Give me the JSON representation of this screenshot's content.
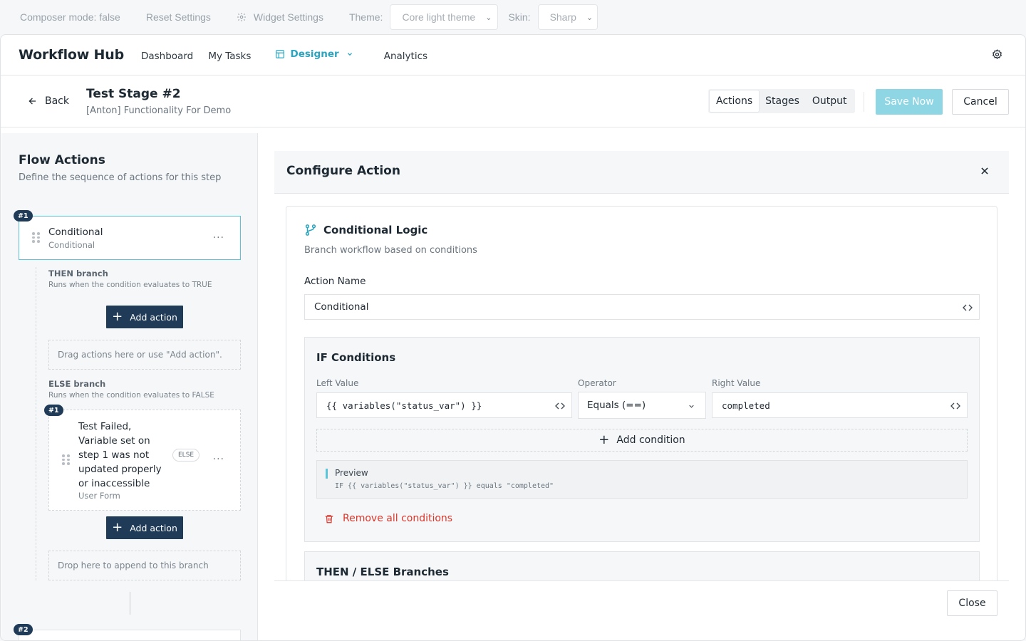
{
  "composer": {
    "mode": "Composer mode: false",
    "reset": "Reset Settings",
    "widget": "Widget Settings",
    "theme_label": "Theme:",
    "theme_value": "Core light theme",
    "skin_label": "Skin:",
    "skin_value": "Sharp"
  },
  "navbar": {
    "brand": "Workflow Hub",
    "items": [
      "Dashboard",
      "My Tasks",
      "Designer",
      "Analytics"
    ],
    "active": "Designer"
  },
  "subheader": {
    "back": "Back",
    "title": "Test Stage #2",
    "subtitle": "[Anton] Functionality For Demo",
    "tabs": [
      "Actions",
      "Stages",
      "Output"
    ],
    "active_tab": "Actions",
    "save": "Save Now",
    "cancel": "Cancel"
  },
  "flow": {
    "title": "Flow Actions",
    "description": "Define the sequence of actions for this step",
    "action1": {
      "badge": "#1",
      "title": "Conditional",
      "subtitle": "Conditional",
      "menu": "..."
    },
    "then_branch": {
      "heading": "THEN branch",
      "description": "Runs when the condition evaluates to TRUE",
      "add": "Add action",
      "dropzone": "Drag actions here or use \"Add action\"."
    },
    "else_branch": {
      "heading": "ELSE branch",
      "description": "Runs when the condition evaluates to FALSE",
      "item": {
        "badge": "#1",
        "title": "Test Failed, Variable set on step 1 was not updated properly or inaccessible",
        "subtitle": "User Form",
        "tag": "ELSE",
        "menu": "..."
      },
      "add": "Add action",
      "dropzone": "Drop here to append to this branch"
    },
    "action2_badge": "#2"
  },
  "config": {
    "title": "Configure Action",
    "section_title": "Conditional Logic",
    "section_desc": "Branch workflow based on conditions",
    "action_name_label": "Action Name",
    "action_name_value": "Conditional",
    "if_title": "IF Conditions",
    "left_label": "Left Value",
    "left_value": "{{ variables(\"status_var\") }}",
    "operator_label": "Operator",
    "operator_value": "Equals (==)",
    "right_label": "Right Value",
    "right_value": "completed",
    "add_condition": "Add condition",
    "preview_label": "Preview",
    "preview_code": "IF {{ variables(\"status_var\") }} equals \"completed\"",
    "remove_all": "Remove all conditions",
    "branches_title": "THEN / ELSE Branches",
    "close": "Close"
  },
  "colors": {
    "accent": "#2aa5c0",
    "primary_dark": "#1f3b57",
    "danger": "#d9362b",
    "save_disabled": "#8fd6e5"
  }
}
